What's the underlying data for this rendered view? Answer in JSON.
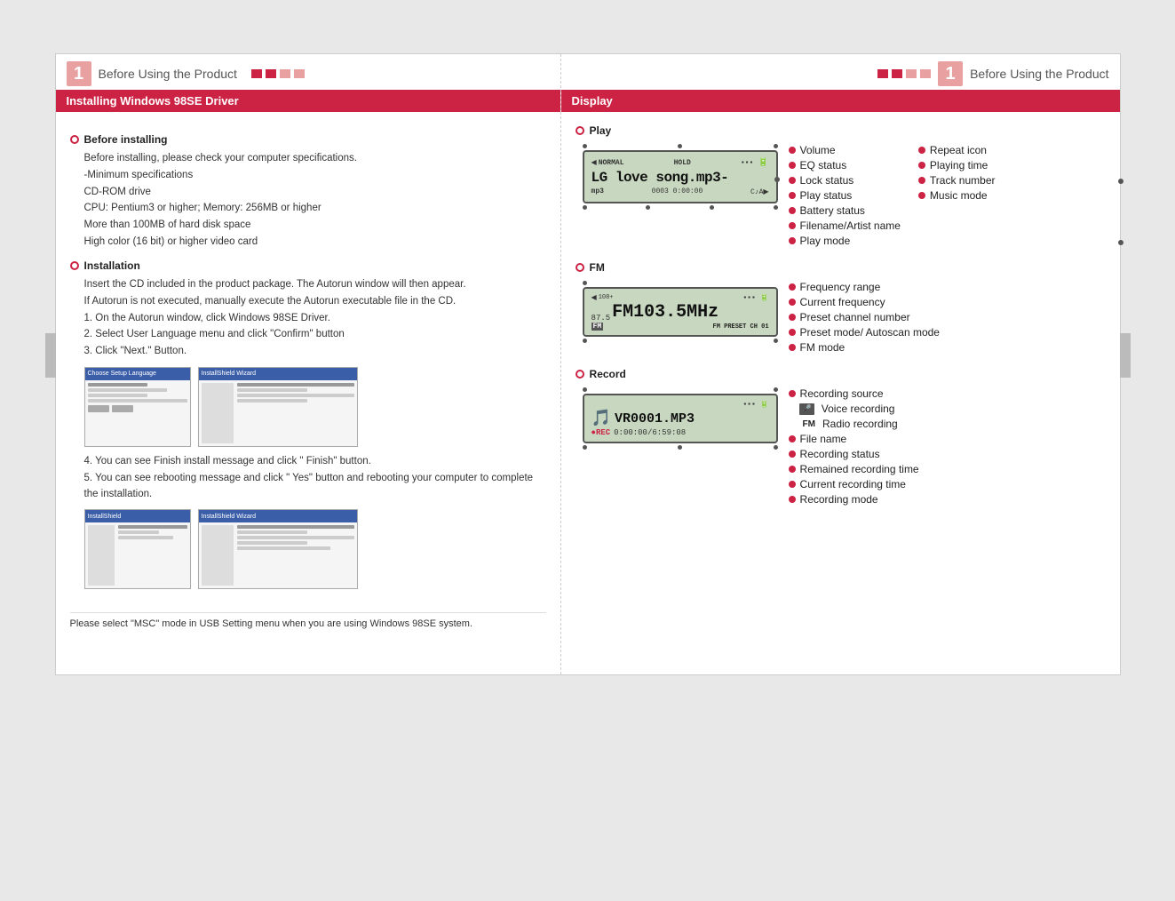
{
  "page": {
    "background_color": "#e8e8e8"
  },
  "left_panel": {
    "title_number": "1",
    "title_text": "Before Using the Product",
    "dots": [
      "filled",
      "filled",
      "filled",
      "filled"
    ],
    "section_heading": "Installing Windows 98SE Driver",
    "before_installing": {
      "title": "Before installing",
      "intro": "Before installing, please check your computer specifications.",
      "items": [
        "-Minimum specifications",
        "CD-ROM drive",
        "CPU: Pentium3 or higher; Memory: 256MB or higher",
        "More than 100MB of hard disk space",
        "High color (16 bit) or higher video card"
      ]
    },
    "installation": {
      "title": "Installation",
      "steps": [
        "Insert the CD included in the product package. The Autorun window will then appear.",
        "If Autorun is not executed, manually execute the Autorun executable file in the CD.",
        "1. On the Autorun window, click Windows 98SE Driver.",
        "2. Select User Language menu and click \"Confirm\" button",
        "3. Click \"Next.\" Button."
      ],
      "step4": "4. You can see Finish install message and click \" Finish\" button.",
      "step5": "5. You can see rebooting message and click \" Yes\" button and rebooting your computer to complete the installation."
    },
    "footer_note": "Please select \"MSC\" mode in USB Setting menu when you are using Windows 98SE system."
  },
  "right_panel": {
    "title_number": "1",
    "title_text": "Before Using the Product",
    "section_heading": "Display",
    "play_section": {
      "title": "Play",
      "lcd_line1_left": "NORMAL",
      "lcd_line1_mid": "HOLD",
      "lcd_line2": "LG love song.mp3-",
      "lcd_line3_left": "mp3",
      "lcd_line3_mid": "0003 0:00:00",
      "lcd_line3_right": "C♪A▶",
      "labels_left": [
        "Volume",
        "EQ status",
        "Lock status",
        "Play status",
        "Battery status",
        "Filename/Artist name",
        "Play mode"
      ],
      "labels_right": [
        "Repeat icon",
        "Playing time",
        "Track number",
        "Music mode"
      ]
    },
    "fm_section": {
      "title": "FM",
      "lcd_line1_left": "108+",
      "lcd_line1_right": "▪▪▪",
      "lcd_freq": "FM103.5MHz",
      "lcd_freq_sub": "87.5",
      "lcd_line3": "FM    PRESET  CH 01",
      "labels": [
        "Frequency range",
        "Current frequency",
        "Preset channel number",
        "Preset mode/ Autoscan mode",
        "FM mode"
      ]
    },
    "record_section": {
      "title": "Record",
      "lcd_line1": "▪▪▪",
      "lcd_filename": "VR0001.MP3",
      "lcd_time": "0:00:00/6:59:08",
      "lcd_rec_label": "●REC",
      "labels": [
        "Recording source",
        "Voice recording",
        "Radio recording",
        "File name",
        "Recording status",
        "Remained recording time",
        "Current recording time",
        "Recording mode"
      ]
    }
  }
}
